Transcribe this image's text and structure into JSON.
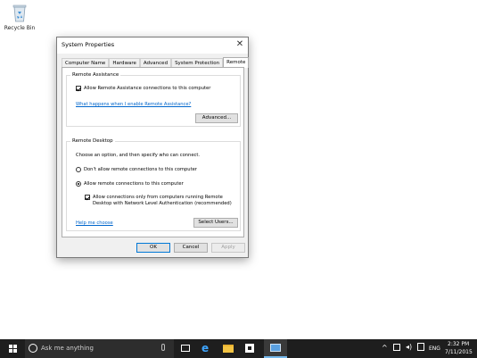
{
  "desktop": {
    "recycle_bin_label": "Recycle Bin"
  },
  "dialog": {
    "title": "System Properties",
    "close_glyph": "✕",
    "tabs": [
      "Computer Name",
      "Hardware",
      "Advanced",
      "System Protection",
      "Remote"
    ],
    "selected_tab": "Remote",
    "remote_assistance": {
      "group_title": "Remote Assistance",
      "allow_checkbox_label": "Allow Remote Assistance connections to this computer",
      "allow_checked": true,
      "help_link": "What happens when I enable Remote Assistance?",
      "advanced_button": "Advanced..."
    },
    "remote_desktop": {
      "group_title": "Remote Desktop",
      "instruction": "Choose an option, and then specify who can connect.",
      "option_dont_allow": "Don't allow remote connections to this computer",
      "option_allow": "Allow remote connections to this computer",
      "selected_option": "allow",
      "nla_label_line1": "Allow connections only from computers running Remote",
      "nla_label_line2": "Desktop with Network Level Authentication (recommended)",
      "nla_checked": true,
      "help_link": "Help me choose",
      "select_users_button": "Select Users..."
    },
    "buttons": {
      "ok": "OK",
      "cancel": "Cancel",
      "apply": "Apply"
    }
  },
  "taskbar": {
    "search_placeholder": "Ask me anything",
    "language": "ENG",
    "time": "2:32 PM",
    "date": "7/11/2015",
    "icons": [
      "windows-start-icon",
      "search-circle-icon",
      "microphone-icon",
      "task-view-icon",
      "edge-icon",
      "file-explorer-icon",
      "store-icon",
      "system-properties-icon"
    ],
    "tray_icons": [
      "chevron-up-icon",
      "network-icon",
      "volume-icon",
      "notification-icon"
    ]
  },
  "colors": {
    "taskbar": "#1e1e1e",
    "link": "#0066cc",
    "default_button_border": "#0078d7"
  }
}
